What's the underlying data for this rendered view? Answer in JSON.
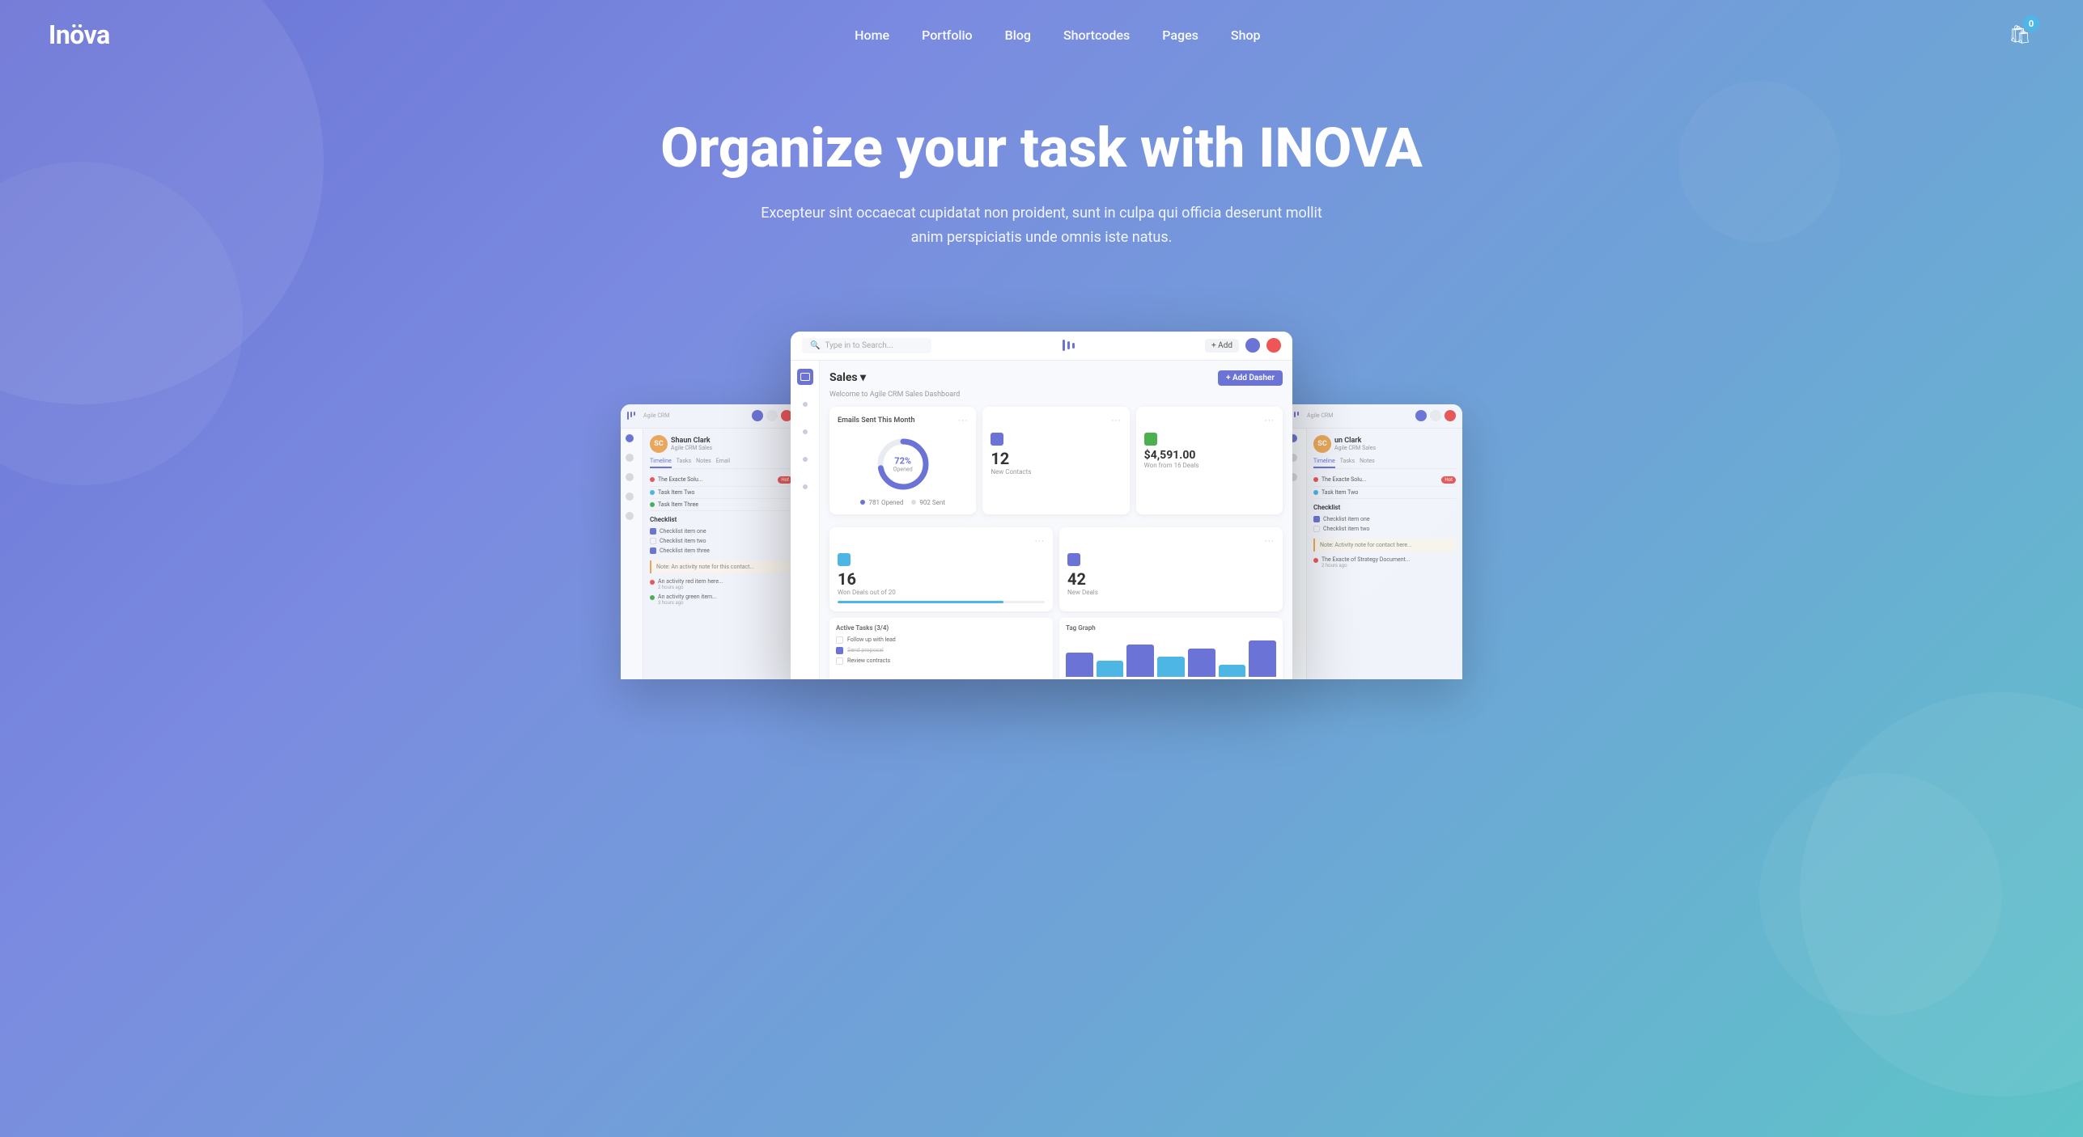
{
  "brand": {
    "name": "Inöva",
    "logo_accent": "ö"
  },
  "nav": {
    "links": [
      {
        "label": "Home",
        "active": true
      },
      {
        "label": "Portfolio"
      },
      {
        "label": "Blog"
      },
      {
        "label": "Shortcodes"
      },
      {
        "label": "Pages"
      },
      {
        "label": "Shop"
      }
    ],
    "cart_count": "0"
  },
  "hero": {
    "title": "Organize your task with INOVA",
    "subtitle": "Excepteur sint occaecat cupidatat non proident, sunt in culpa qui officia deserunt mollit anim perspiciatis unde omnis iste natus."
  },
  "dashboard": {
    "topbar": {
      "search_placeholder": "Type in to Search...",
      "add_button": "+ Add"
    },
    "header": {
      "title": "Sales ▾",
      "welcome": "Welcome to Agile CRM Sales Dashboard",
      "add_dash_btn": "+ Add Dasher"
    },
    "widgets": {
      "emails_sent": {
        "title": "Emails Sent This Month",
        "percentage": "72%",
        "label": "Opened",
        "opened": "781 Opened",
        "sent": "902 Sent"
      },
      "new_contacts": {
        "title": "12",
        "subtitle": "New Contacts",
        "icon_color": "#6b74d6"
      },
      "won_deals": {
        "title": "$4,591.00",
        "subtitle": "Won from 16 Deals",
        "icon_color": "#4caf50"
      },
      "deals_out_of": {
        "title": "16",
        "subtitle": "Won Deals out of 20",
        "icon_color": "#4db6e4"
      },
      "new_deals": {
        "title": "42",
        "subtitle": "New Deals",
        "icon_color": "#6b74d6"
      }
    },
    "bottom": {
      "active_tasks": "Active Tasks (3/4)",
      "tag_graph": "Tag Graph"
    }
  },
  "side_panels": {
    "left": {
      "profile_name": "Shaun Clark",
      "profile_role": "Agile CRM Sales",
      "tabs": [
        "Timeline",
        "Tasks",
        "Notes",
        "Email"
      ],
      "tasks": [
        {
          "text": "The Exacte Solu...",
          "color": "#e55",
          "badge": "Hot"
        },
        {
          "text": "Task Item Two",
          "color": "#4db6e4",
          "badge": ""
        },
        {
          "text": "Task Item Three",
          "color": "#4caf50",
          "badge": ""
        }
      ],
      "checklist_title": "Checklist",
      "checklist": [
        {
          "text": "Checklist item one",
          "checked": true
        },
        {
          "text": "Checklist item two",
          "checked": false
        },
        {
          "text": "Checklist item three",
          "checked": true
        }
      ]
    },
    "right": {
      "profile_name": "un Clark",
      "profile_role": "Agile CRM Sales"
    }
  },
  "colors": {
    "primary": "#6b74d6",
    "accent_green": "#4caf50",
    "accent_blue": "#4db6e4",
    "accent_orange": "#f0a855",
    "accent_red": "#e55",
    "bg_hero_start": "#6b74d6",
    "bg_hero_end": "#5ec4c8"
  }
}
